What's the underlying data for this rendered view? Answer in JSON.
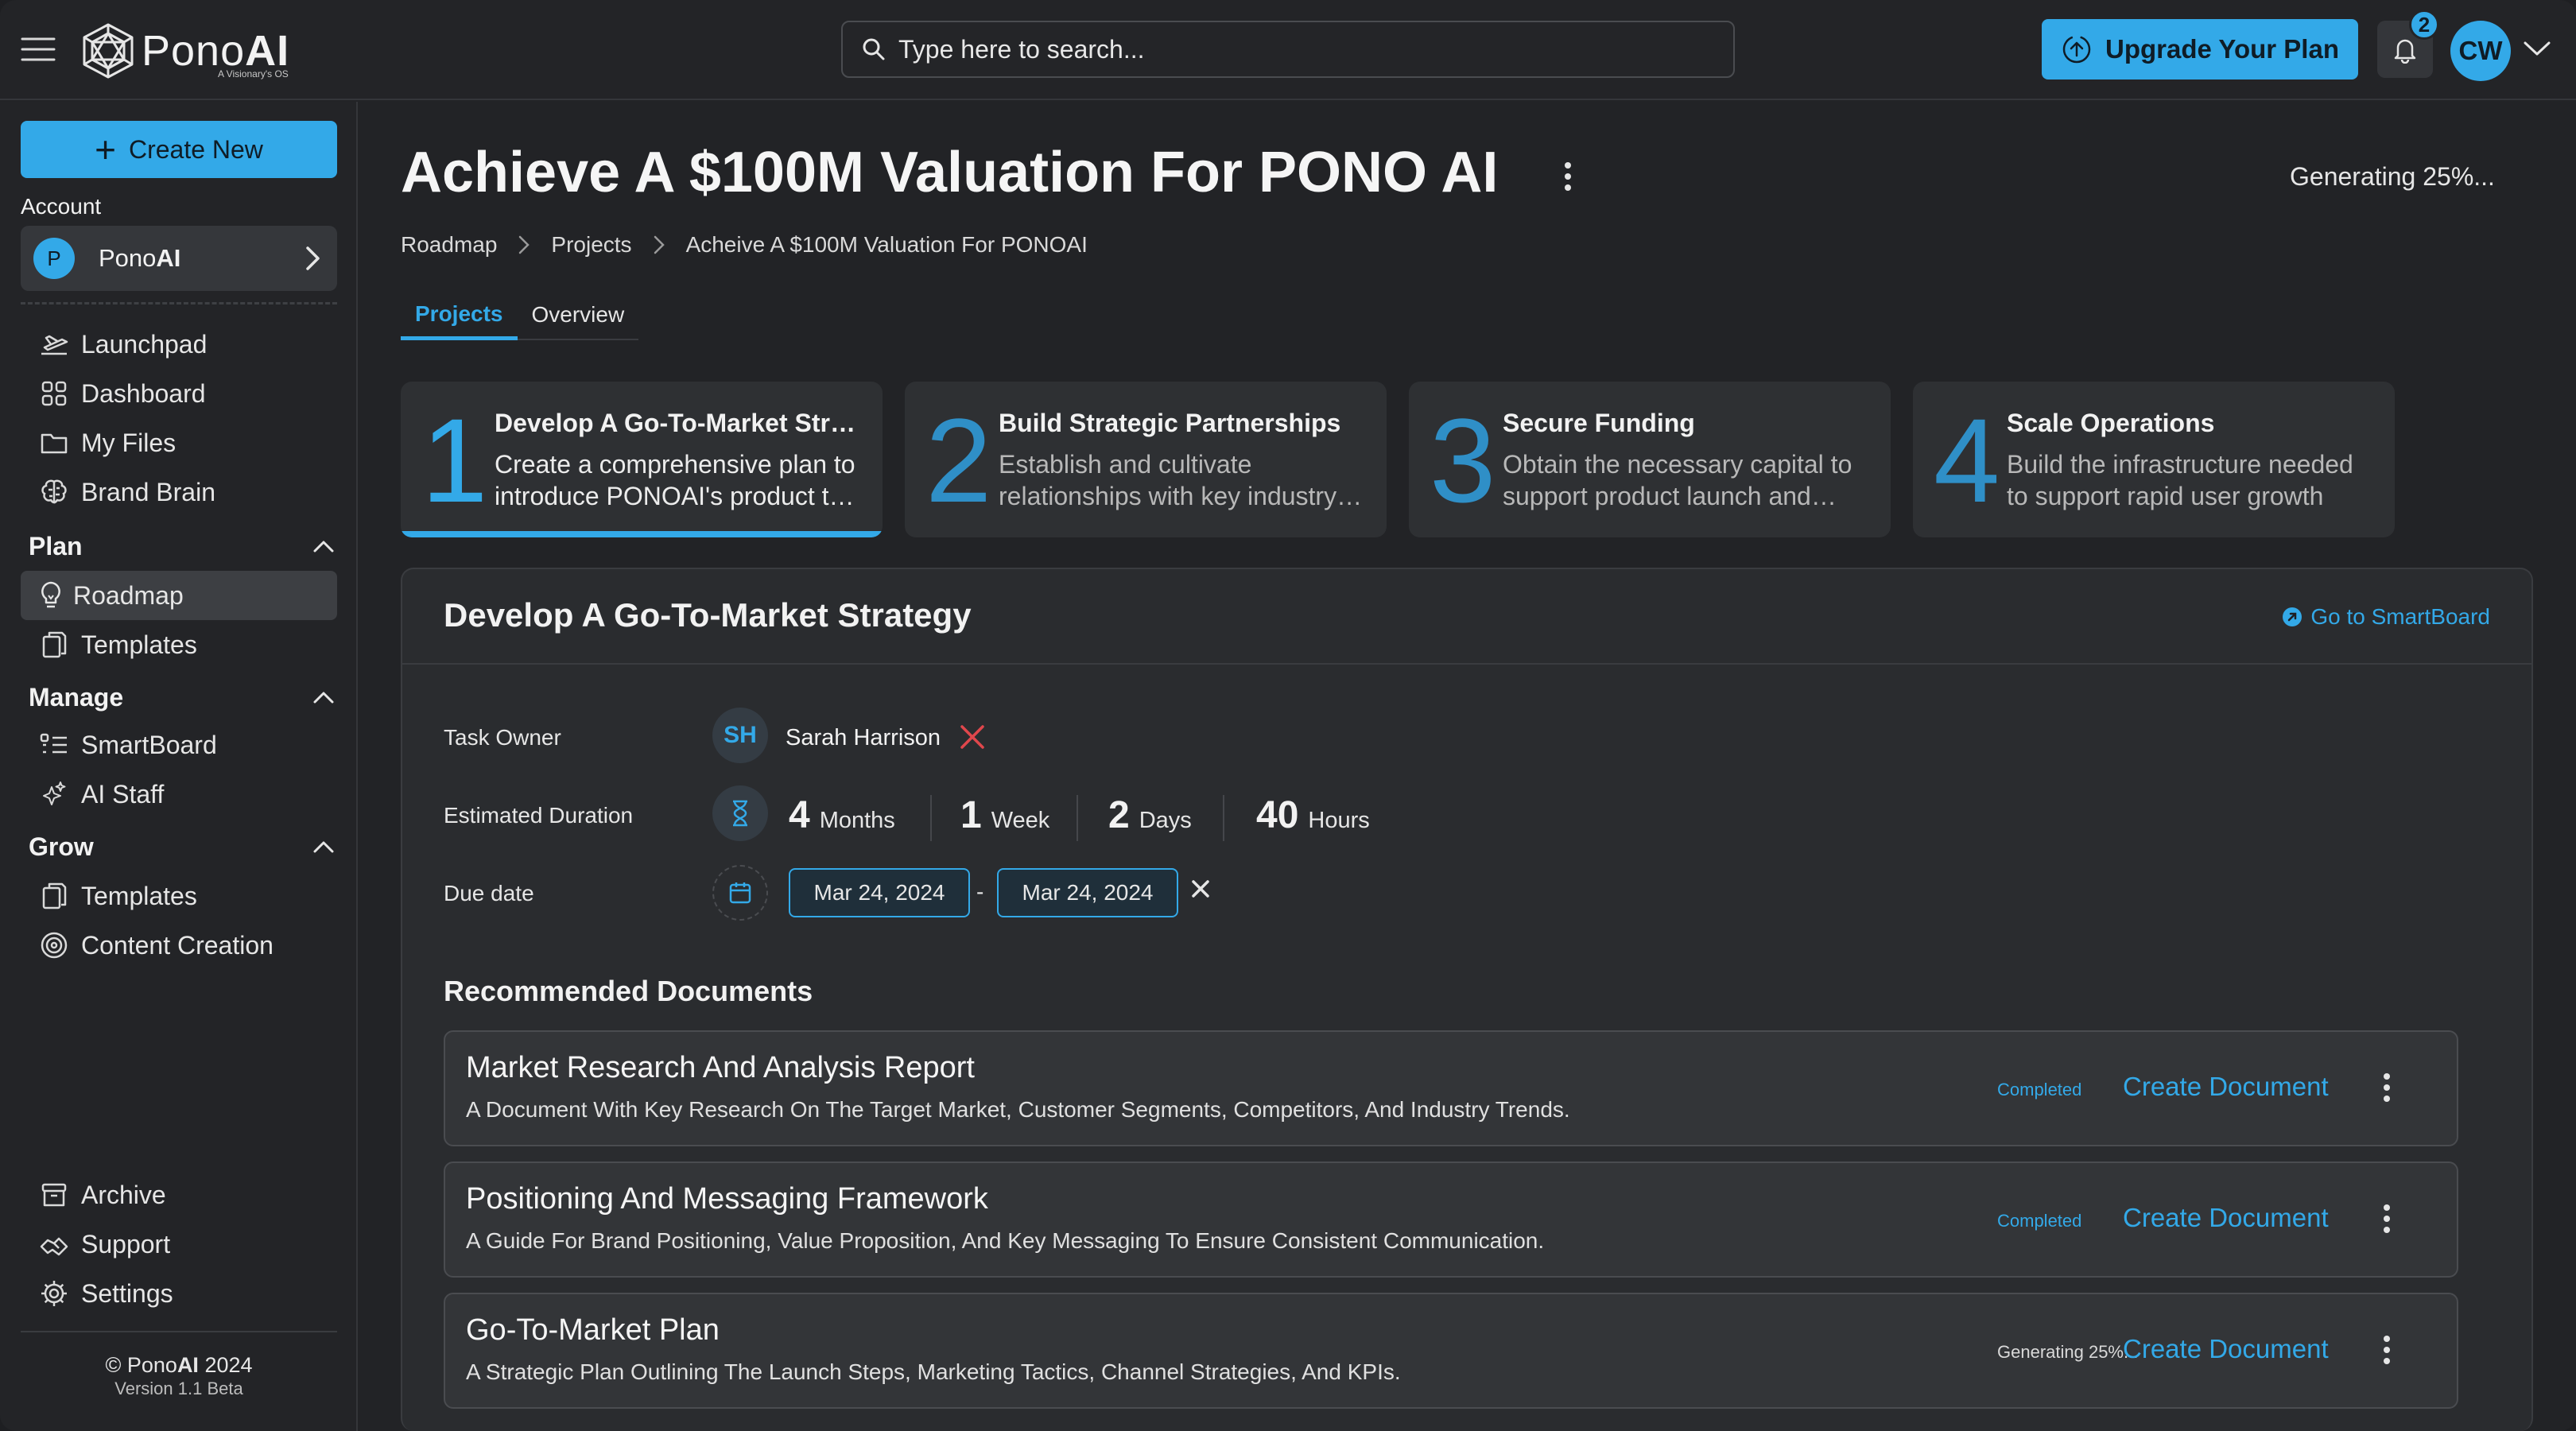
{
  "brand": {
    "name_light": "Pono",
    "name_bold": "AI",
    "tagline": "A Visionary's OS"
  },
  "search": {
    "placeholder": "Type here to search..."
  },
  "header": {
    "upgrade_label": "Upgrade Your Plan",
    "notification_count": "2",
    "user_initials": "CW"
  },
  "sidebar": {
    "create_label": "Create New",
    "account_label": "Account",
    "account": {
      "initial": "P",
      "name_light": "Pono",
      "name_bold": "AI"
    },
    "top_items": [
      {
        "label": "Launchpad",
        "icon": "launchpad-icon"
      },
      {
        "label": "Dashboard",
        "icon": "dashboard-icon"
      },
      {
        "label": "My Files",
        "icon": "folder-icon"
      },
      {
        "label": "Brand Brain",
        "icon": "brain-icon"
      }
    ],
    "sections": [
      {
        "title": "Plan",
        "items": [
          {
            "label": "Roadmap",
            "icon": "bulb-icon",
            "active": true
          },
          {
            "label": "Templates",
            "icon": "templates-icon"
          }
        ]
      },
      {
        "title": "Manage",
        "items": [
          {
            "label": "SmartBoard",
            "icon": "smartboard-icon"
          },
          {
            "label": "AI Staff",
            "icon": "sparkle-icon"
          }
        ]
      },
      {
        "title": "Grow",
        "items": [
          {
            "label": "Templates",
            "icon": "templates-icon"
          },
          {
            "label": "Content Creation",
            "icon": "spiral-icon"
          }
        ]
      }
    ],
    "bottom_items": [
      {
        "label": "Archive",
        "icon": "archive-icon"
      },
      {
        "label": "Support",
        "icon": "support-icon"
      },
      {
        "label": "Settings",
        "icon": "gear-icon"
      }
    ],
    "copyright_prefix": "© Pono",
    "copyright_bold": "AI",
    "copyright_year": " 2024",
    "version": "Version 1.1 Beta"
  },
  "main": {
    "title": "Achieve A $100M Valuation For PONO AI",
    "generating_status": "Generating 25%...",
    "breadcrumbs": [
      "Roadmap",
      "Projects",
      "Acheive A $100M Valuation For PONOAI"
    ],
    "tabs": [
      "Projects",
      "Overview"
    ],
    "steps": [
      {
        "number": "1",
        "title": "Develop A Go-To-Market Strategy",
        "desc": "Create a comprehensive plan to introduce PONOAI's product to the market",
        "active": true
      },
      {
        "number": "2",
        "title": "Build Strategic Partnerships",
        "desc": "Establish and cultivate relationships with key industry partners"
      },
      {
        "number": "3",
        "title": "Secure Funding",
        "desc": "Obtain the necessary capital to support product launch and growth"
      },
      {
        "number": "4",
        "title": "Scale Operations",
        "desc": "Build the infrastructure needed to support rapid user growth"
      }
    ],
    "detail": {
      "title": "Develop A Go-To-Market Strategy",
      "smartboard_link": "Go to SmartBoard",
      "task_owner_label": "Task Owner",
      "owner_initials": "SH",
      "owner_name": "Sarah Harrison",
      "duration_label": "Estimated Duration",
      "duration": [
        {
          "value": "4",
          "unit": "Months"
        },
        {
          "value": "1",
          "unit": "Week"
        },
        {
          "value": "2",
          "unit": "Days"
        },
        {
          "value": "40",
          "unit": "Hours"
        }
      ],
      "due_label": "Due date",
      "due_start": "Mar 24, 2024",
      "due_end": "Mar 24, 2024",
      "date_separator": "-",
      "recommended_title": "Recommended Documents",
      "documents": [
        {
          "title": "Market Research And Analysis Report",
          "desc": "A Document With Key Research On The Target Market, Customer Segments, Competitors, And Industry Trends.",
          "status": "Completed",
          "action": "Create Document"
        },
        {
          "title": "Positioning And Messaging Framework",
          "desc": "A Guide For Brand Positioning, Value Proposition, And Key Messaging To Ensure Consistent Communication.",
          "status": "Completed",
          "action": "Create Document"
        },
        {
          "title": "Go-To-Market Plan",
          "desc": "A Strategic Plan Outlining The Launch Steps, Marketing Tactics, Channel Strategies, And KPIs.",
          "status": "Generating 25%...",
          "action": "Create Document"
        }
      ]
    }
  },
  "colors": {
    "accent": "#33a9e8",
    "background": "#222326",
    "card": "#2e3033",
    "danger": "#e0474c"
  }
}
